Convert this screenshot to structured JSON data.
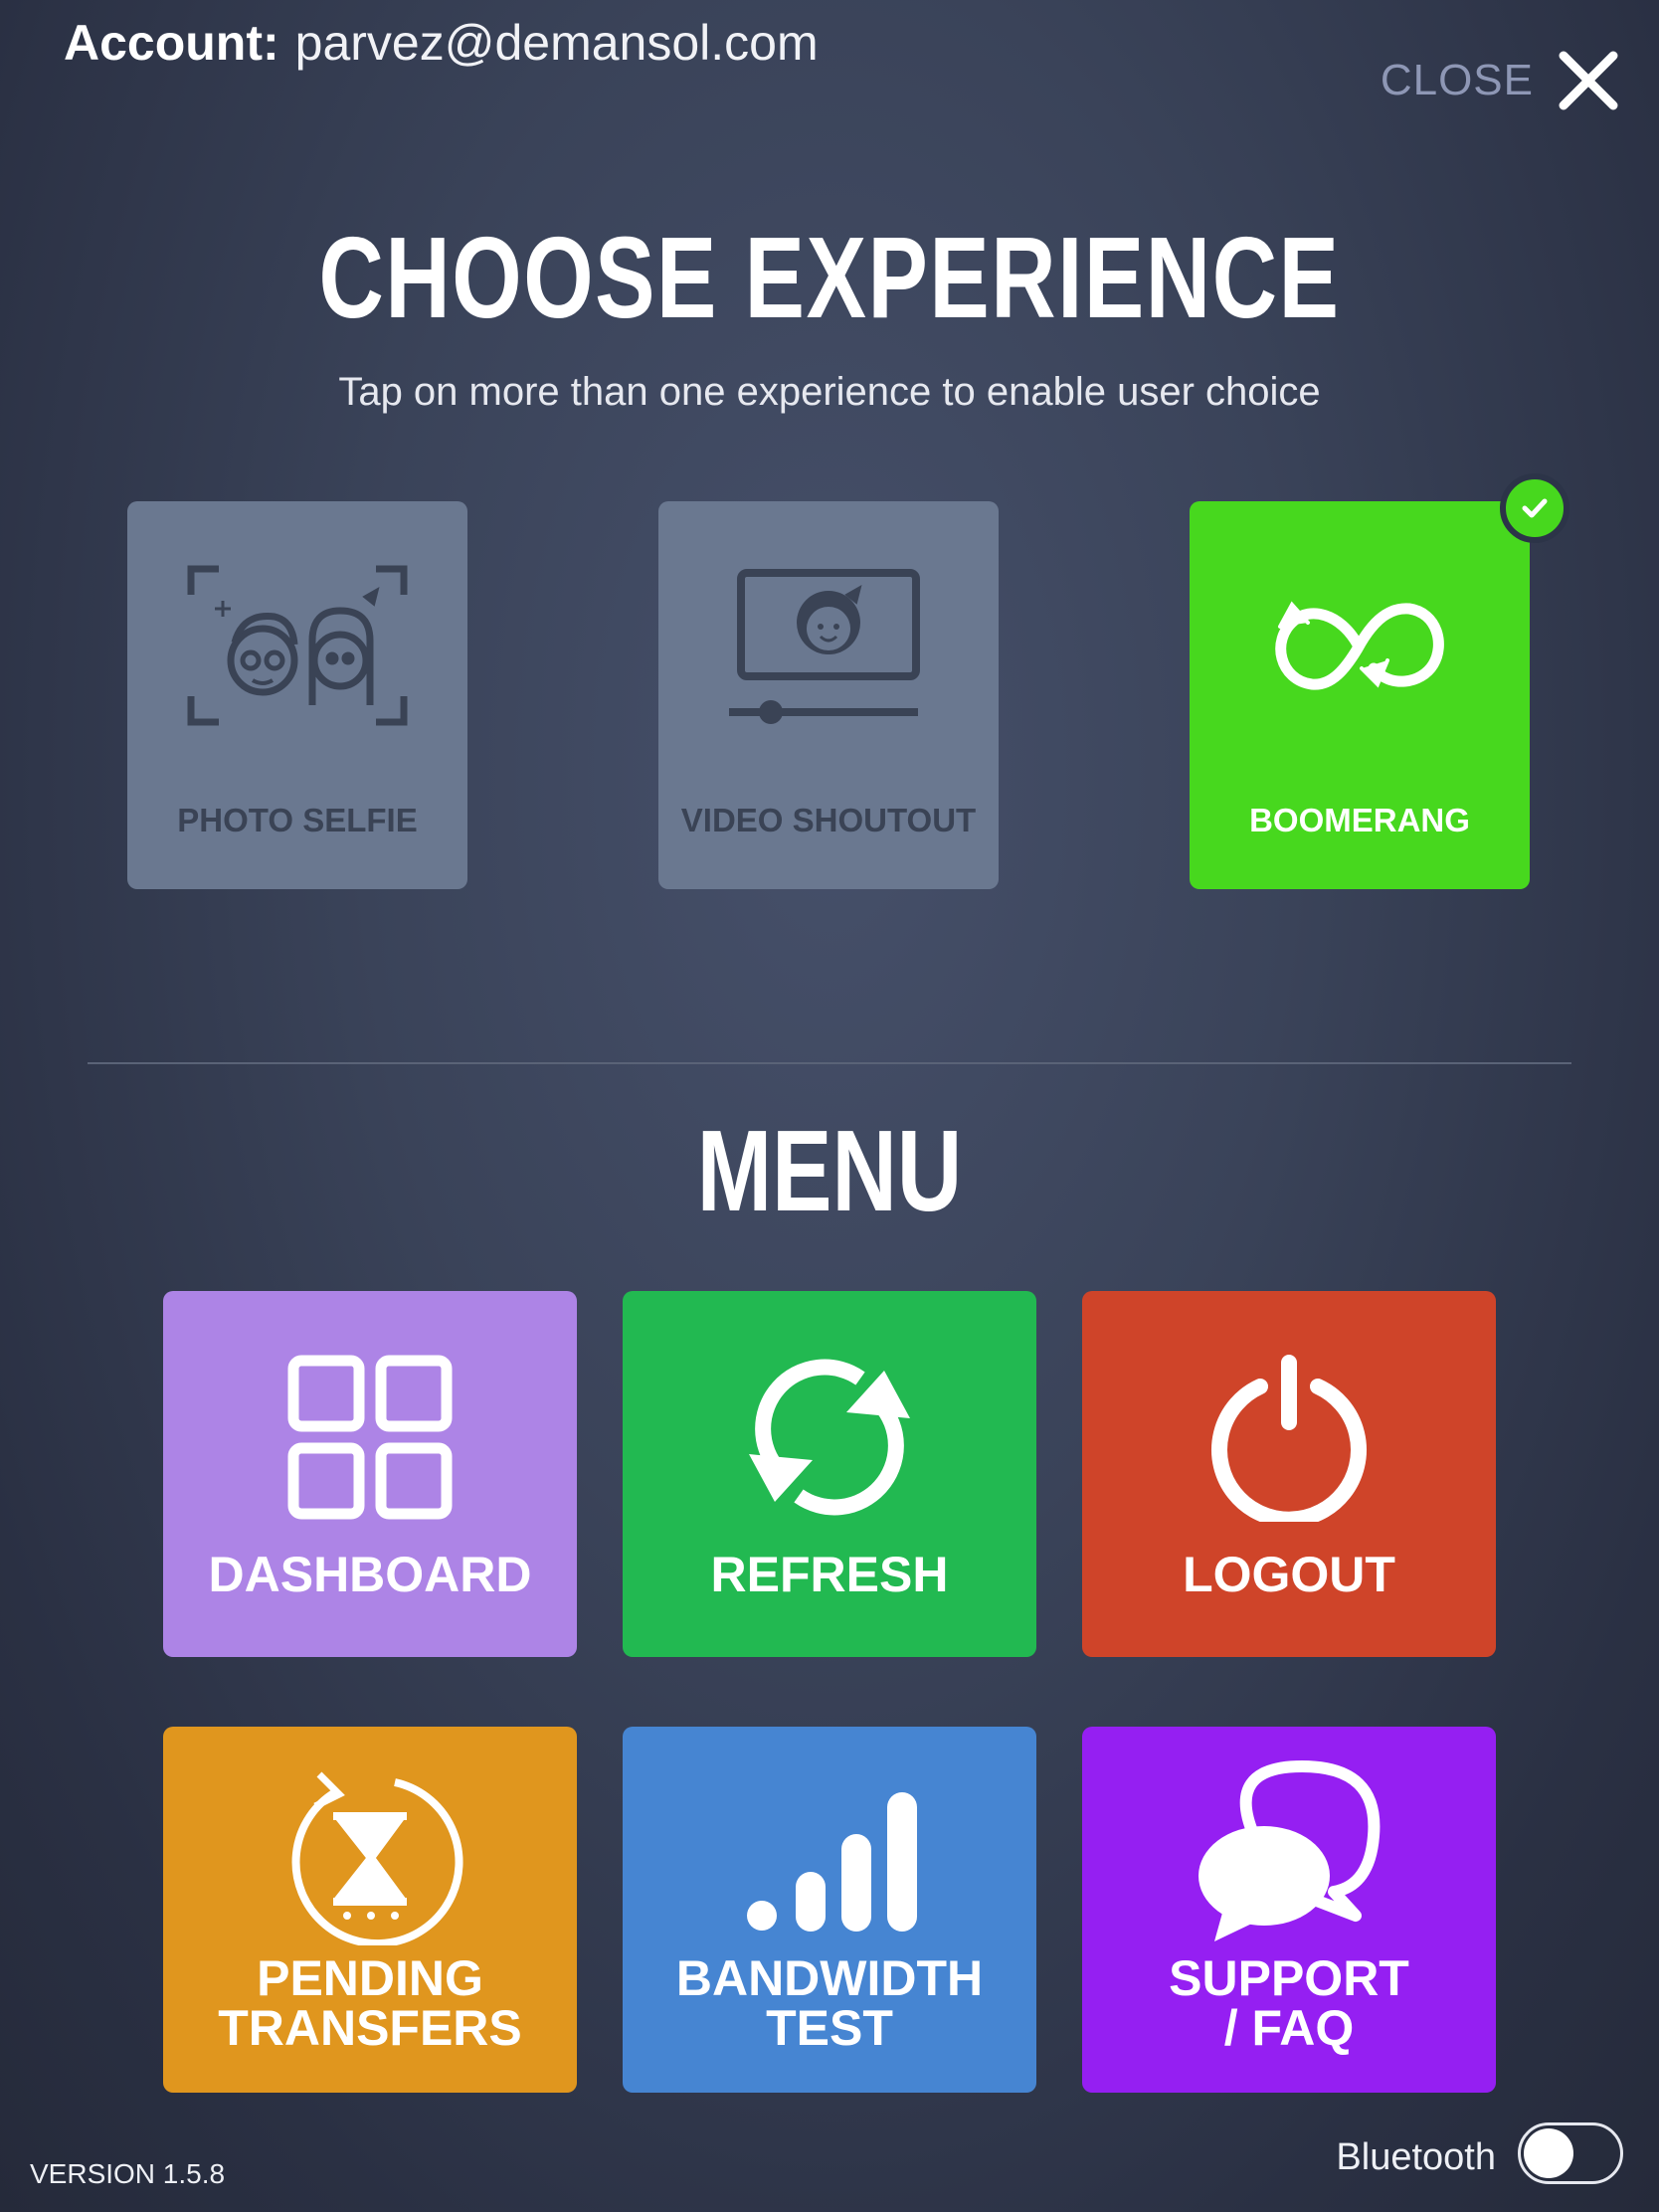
{
  "header": {
    "account_label": "Account:",
    "account_email": "parvez@demansol.com",
    "close_label": "CLOSE"
  },
  "experience": {
    "title": "CHOOSE EXPERIENCE",
    "subtitle": "Tap on more than one experience to enable user choice",
    "items": [
      {
        "label": "PHOTO SELFIE",
        "icon": "photo-selfie-icon",
        "selected": false
      },
      {
        "label": "VIDEO SHOUTOUT",
        "icon": "video-shoutout-icon",
        "selected": false
      },
      {
        "label": "BOOMERANG",
        "icon": "boomerang-icon",
        "selected": true
      }
    ]
  },
  "menu": {
    "title": "MENU",
    "items": [
      {
        "label": "DASHBOARD",
        "icon": "dashboard-grid-icon",
        "color": "#ad84e6"
      },
      {
        "label": "REFRESH",
        "icon": "refresh-icon",
        "color": "#22b951"
      },
      {
        "label": "LOGOUT",
        "icon": "power-icon",
        "color": "#cf4429"
      },
      {
        "label_line1": "PENDING",
        "label_line2": "TRANSFERS",
        "icon": "hourglass-icon",
        "color": "#e0961e"
      },
      {
        "label_line1": "BANDWIDTH",
        "label_line2": "TEST",
        "icon": "signal-bars-icon",
        "color": "#4685d2"
      },
      {
        "label_line1": "SUPPORT",
        "label_line2": "/ FAQ",
        "icon": "chat-bubbles-icon",
        "color": "#951ff2"
      }
    ]
  },
  "footer": {
    "version": "VERSION 1.5.8",
    "bluetooth_label": "Bluetooth",
    "bluetooth_on": false
  }
}
